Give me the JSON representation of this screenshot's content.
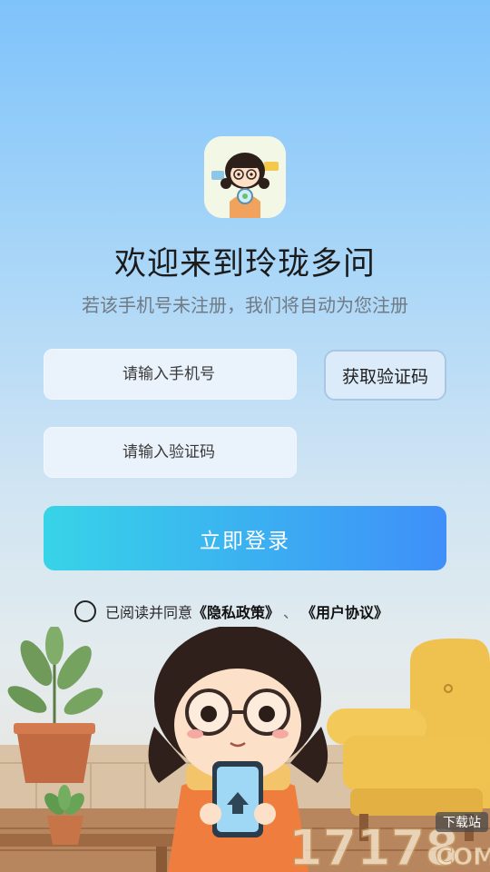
{
  "app": {
    "title": "欢迎来到玲珑多问",
    "subtitle": "若该手机号未注册，我们将自动为您注册"
  },
  "form": {
    "phone_placeholder": "请输入手机号",
    "code_placeholder": "请输入验证码",
    "get_code_label": "获取验证码",
    "login_label": "立即登录"
  },
  "agreement": {
    "prefix": "已阅读并同意",
    "privacy_link": "《隐私政策》",
    "separator": "、",
    "terms_link": "《用户协议》"
  },
  "watermark": {
    "number": "17178",
    "tag": "下载站",
    "suffix": "COM"
  },
  "colors": {
    "button_start": "#37d4e8",
    "button_end": "#3f8ff9",
    "input_bg": "#eaf2fb",
    "subtitle": "#6f7a84"
  }
}
